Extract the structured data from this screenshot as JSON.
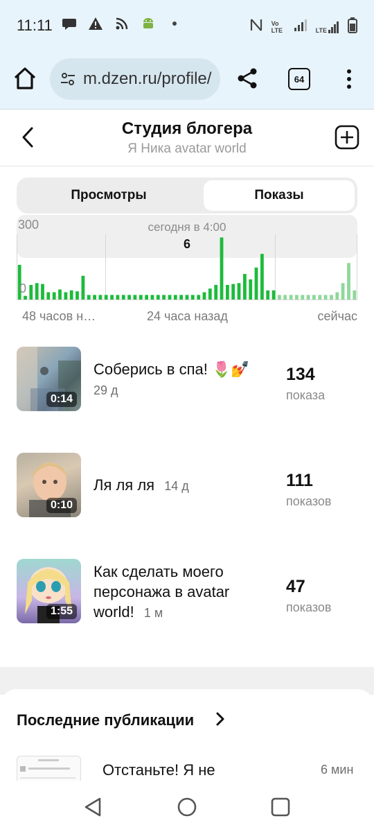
{
  "status_bar": {
    "time": "11:11",
    "left_icons": [
      "chat-icon",
      "warning-icon",
      "rss-icon",
      "android-icon",
      "dot-icon"
    ],
    "right_icons": [
      "nfc-icon",
      "volte-icon",
      "signal-icon",
      "lte-signal-icon",
      "battery-icon"
    ],
    "volte_text": "Vo LTE",
    "lte_text": "LTE"
  },
  "browser": {
    "url": "m.dzen.ru/profile/",
    "tab_count": "64"
  },
  "header": {
    "title": "Студия блогера",
    "subtitle": "Я Ника avatar world"
  },
  "tabs": {
    "views": "Просмотры",
    "impressions": "Показы",
    "selected": "impressions"
  },
  "chart_data": {
    "type": "bar",
    "y_max_label": "300",
    "y_min_label": "0",
    "ylim": [
      0,
      300
    ],
    "tooltip_time": "сегодня в 4:00",
    "tooltip_value": "6",
    "x_tick_labels": [
      "48 часов н…",
      "24 часа назад",
      "сейчас"
    ],
    "values": [
      38,
      4,
      16,
      18,
      17,
      8,
      8,
      11,
      8,
      10,
      9,
      26,
      5,
      5,
      5,
      5,
      5,
      5,
      5,
      5,
      5,
      5,
      5,
      5,
      5,
      5,
      5,
      5,
      5,
      5,
      5,
      5,
      8,
      12,
      16,
      68,
      16,
      17,
      18,
      28,
      22,
      35,
      50,
      10,
      10,
      5,
      5,
      5,
      5,
      5,
      5,
      5,
      5,
      5,
      5,
      8,
      18,
      40,
      10
    ],
    "highlight_index": 35,
    "today_start_index": 45,
    "bar_color": "#1dbb3c",
    "today_bar_color": "#8ed89a"
  },
  "videos": [
    {
      "title": "Соберись в спа! 🌷💅",
      "age": "29 д",
      "duration": "0:14",
      "count": "134",
      "unit": "показа"
    },
    {
      "title": "Ля ля ля",
      "age": "14 д",
      "duration": "0:10",
      "count": "111",
      "unit": "показов"
    },
    {
      "title": "Как сделать моего персонажа в avatar world!",
      "age": "1 м",
      "duration": "1:55",
      "count": "47",
      "unit": "показов"
    }
  ],
  "latest": {
    "title": "Последние публикации",
    "item_title": "Отстаньте! Я не",
    "item_age": "6 мин"
  },
  "colors": {
    "accent_green": "#1dbb3c",
    "browser_bg": "#e8f4fb"
  }
}
